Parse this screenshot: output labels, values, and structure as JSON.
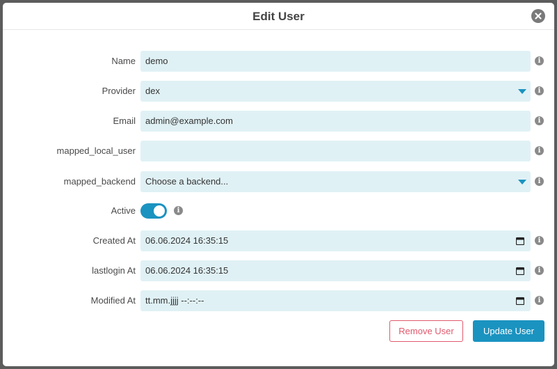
{
  "dialog": {
    "title": "Edit User",
    "close_icon": "close-icon"
  },
  "fields": {
    "name": {
      "label": "Name",
      "value": "demo"
    },
    "provider": {
      "label": "Provider",
      "value": "dex"
    },
    "email": {
      "label": "Email",
      "value": "admin@example.com"
    },
    "mapped_local_user": {
      "label": "mapped_local_user",
      "value": ""
    },
    "mapped_backend": {
      "label": "mapped_backend",
      "value": "Choose a backend..."
    },
    "active": {
      "label": "Active",
      "enabled": true
    },
    "created_at": {
      "label": "Created At",
      "value": "06.06.2024  16:35:15"
    },
    "lastlogin_at": {
      "label": "lastlogin At",
      "value": "06.06.2024  16:35:15"
    },
    "modified_at": {
      "label": "Modified At",
      "value": "tt.mm.jjjj  --:--:--"
    }
  },
  "info_glyph": "i",
  "buttons": {
    "remove": "Remove User",
    "update": "Update User"
  },
  "colors": {
    "accent": "#1a93c0",
    "danger": "#e0596c",
    "field_bg": "#e0f1f5"
  }
}
